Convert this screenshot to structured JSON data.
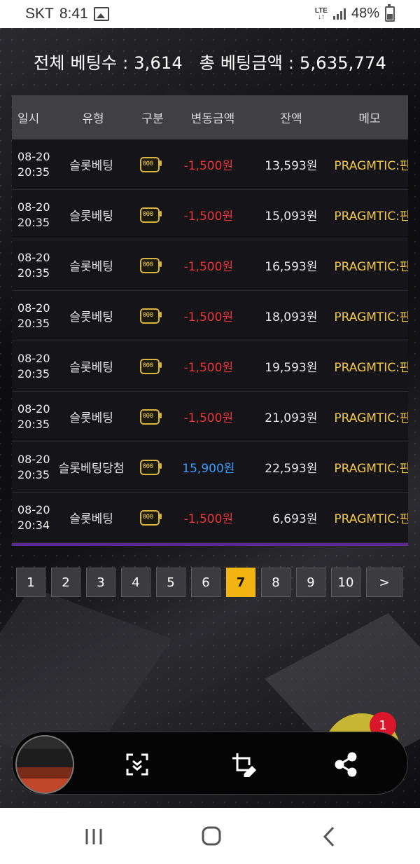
{
  "status_bar": {
    "carrier": "SKT",
    "time": "8:41",
    "network": "LTE",
    "battery": "48%"
  },
  "summary": {
    "bet_count_label": "전체 베팅수 : 3,614",
    "bet_amount_label": "총 베팅금액 : 5,635,774"
  },
  "table": {
    "headers": [
      "일시",
      "유형",
      "구분",
      "변동금액",
      "잔액",
      "메모"
    ],
    "rows": [
      {
        "date": "08-20",
        "time": "20:35",
        "type": "슬롯베팅",
        "icon": "slot-machine-icon",
        "amount": "-1,500원",
        "amount_sign": "neg",
        "balance": "13,593원",
        "memo": "PRAGMTIC:판"
      },
      {
        "date": "08-20",
        "time": "20:35",
        "type": "슬롯베팅",
        "icon": "slot-machine-icon",
        "amount": "-1,500원",
        "amount_sign": "neg",
        "balance": "15,093원",
        "memo": "PRAGMTIC:판"
      },
      {
        "date": "08-20",
        "time": "20:35",
        "type": "슬롯베팅",
        "icon": "slot-machine-icon",
        "amount": "-1,500원",
        "amount_sign": "neg",
        "balance": "16,593원",
        "memo": "PRAGMTIC:판"
      },
      {
        "date": "08-20",
        "time": "20:35",
        "type": "슬롯베팅",
        "icon": "slot-machine-icon",
        "amount": "-1,500원",
        "amount_sign": "neg",
        "balance": "18,093원",
        "memo": "PRAGMTIC:판"
      },
      {
        "date": "08-20",
        "time": "20:35",
        "type": "슬롯베팅",
        "icon": "slot-machine-icon",
        "amount": "-1,500원",
        "amount_sign": "neg",
        "balance": "19,593원",
        "memo": "PRAGMTIC:판"
      },
      {
        "date": "08-20",
        "time": "20:35",
        "type": "슬롯베팅",
        "icon": "slot-machine-icon",
        "amount": "-1,500원",
        "amount_sign": "neg",
        "balance": "21,093원",
        "memo": "PRAGMTIC:판"
      },
      {
        "date": "08-20",
        "time": "20:35",
        "type": "슬롯베팅당첨",
        "icon": "slot-machine-icon",
        "amount": "15,900원",
        "amount_sign": "pos",
        "balance": "22,593원",
        "memo": "PRAGMTIC:판"
      },
      {
        "date": "08-20",
        "time": "20:34",
        "type": "슬롯베팅",
        "icon": "slot-machine-icon",
        "amount": "-1,500원",
        "amount_sign": "neg",
        "balance": "6,693원",
        "memo": "PRAGMTIC:판"
      }
    ]
  },
  "pagination": {
    "pages": [
      "1",
      "2",
      "3",
      "4",
      "5",
      "6",
      "7",
      "8",
      "9",
      "10"
    ],
    "current": "7",
    "next_label": ">"
  },
  "notification_badge": "1",
  "colors": {
    "negative": "#e8343b",
    "positive": "#3b9bff",
    "memo": "#f2c94c",
    "active_page": "#f1b411",
    "badge": "#d9162a"
  },
  "toolbar_icons": [
    "scroll-capture-icon",
    "crop-edit-icon",
    "share-icon"
  ],
  "nav_icons": [
    "recent-apps-icon",
    "home-icon",
    "back-icon"
  ]
}
